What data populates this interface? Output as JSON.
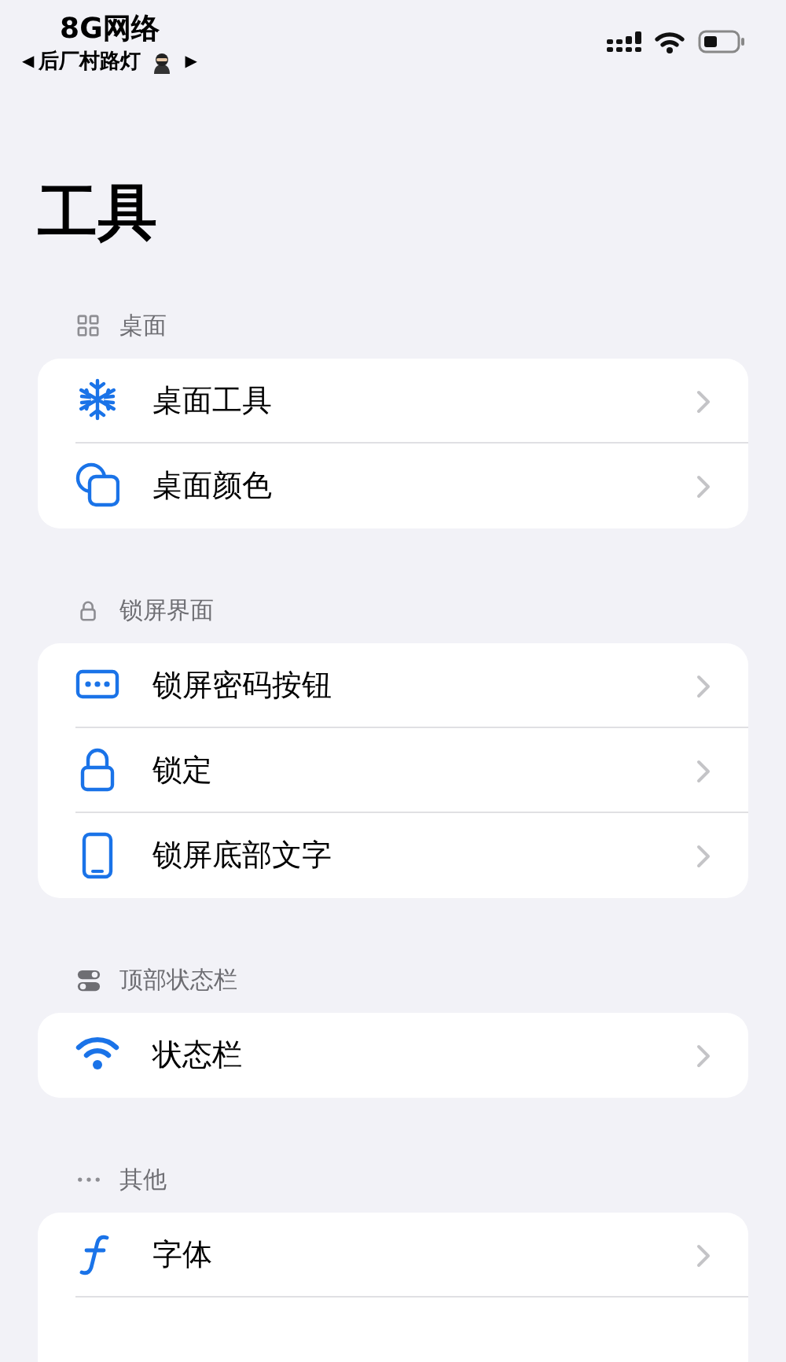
{
  "status_bar": {
    "carrier": "8G网络",
    "prev_arrow": "◀",
    "network_name": "后厂村路灯",
    "next_arrow": "▶"
  },
  "title": "工具",
  "sections": [
    {
      "header": "桌面",
      "rows": [
        {
          "label": "桌面工具"
        },
        {
          "label": "桌面颜色"
        }
      ]
    },
    {
      "header": "锁屏界面",
      "rows": [
        {
          "label": "锁屏密码按钮"
        },
        {
          "label": "锁定"
        },
        {
          "label": "锁屏底部文字"
        }
      ]
    },
    {
      "header": "顶部状态栏",
      "rows": [
        {
          "label": "状态栏"
        }
      ]
    },
    {
      "header": "其他",
      "rows": [
        {
          "label": "字体"
        }
      ]
    }
  ]
}
